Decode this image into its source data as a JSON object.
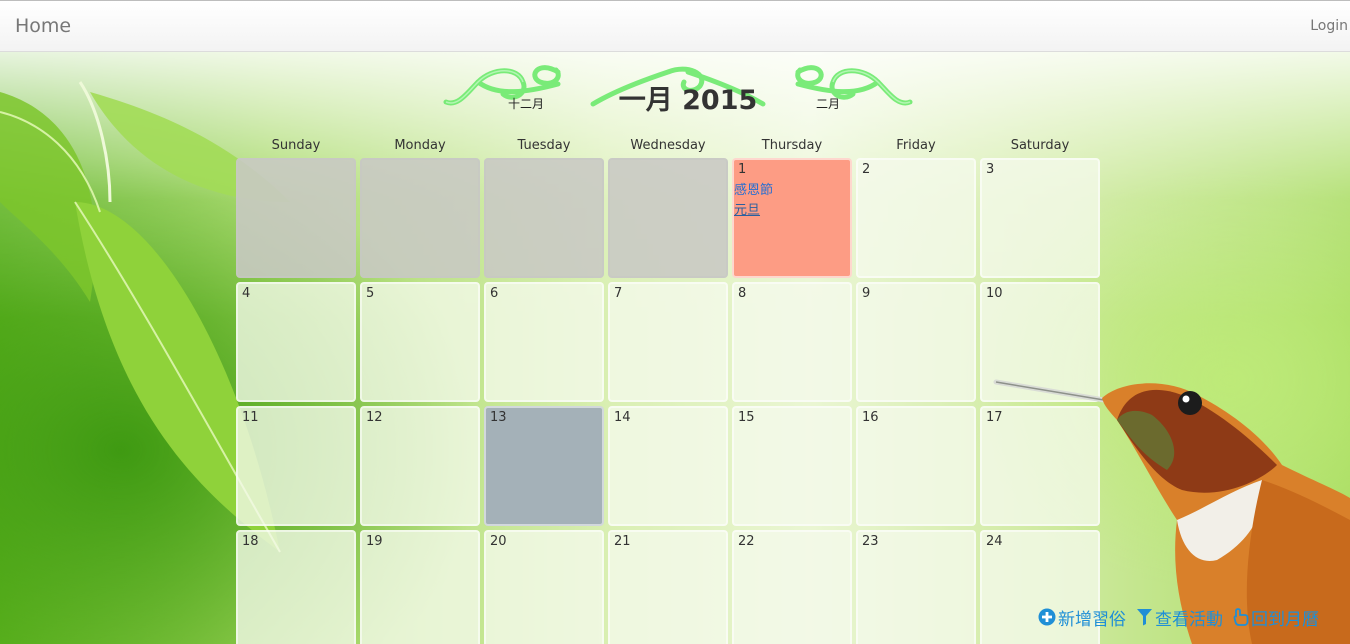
{
  "navbar": {
    "home_label": "Home",
    "login_label": "Login"
  },
  "calendar": {
    "title": "一月 2015",
    "prev_month_label": "十二月",
    "next_month_label": "二月",
    "weekdays": [
      "Sunday",
      "Monday",
      "Tuesday",
      "Wednesday",
      "Thursday",
      "Friday",
      "Saturday"
    ],
    "highlight_color": "#fd9c84",
    "today_color": "#a4b1b8",
    "days": {
      "d1": {
        "num": "1",
        "events": [
          "感恩節",
          "元旦"
        ]
      },
      "d2": {
        "num": "2"
      },
      "d3": {
        "num": "3"
      },
      "d4": {
        "num": "4"
      },
      "d5": {
        "num": "5"
      },
      "d6": {
        "num": "6"
      },
      "d7": {
        "num": "7"
      },
      "d8": {
        "num": "8"
      },
      "d9": {
        "num": "9"
      },
      "d10": {
        "num": "10"
      },
      "d11": {
        "num": "11"
      },
      "d12": {
        "num": "12"
      },
      "d13": {
        "num": "13"
      },
      "d14": {
        "num": "14"
      },
      "d15": {
        "num": "15"
      },
      "d16": {
        "num": "16"
      },
      "d17": {
        "num": "17"
      },
      "d18": {
        "num": "18"
      },
      "d19": {
        "num": "19"
      },
      "d20": {
        "num": "20"
      },
      "d21": {
        "num": "21"
      },
      "d22": {
        "num": "22"
      },
      "d23": {
        "num": "23"
      },
      "d24": {
        "num": "24"
      }
    }
  },
  "actions": {
    "add_label": "新增習俗",
    "view_label": "查看活動",
    "back_label": "回到月曆",
    "add_icon": "plus-circle-icon",
    "view_icon": "filter-icon",
    "back_icon": "hand-point-icon"
  }
}
